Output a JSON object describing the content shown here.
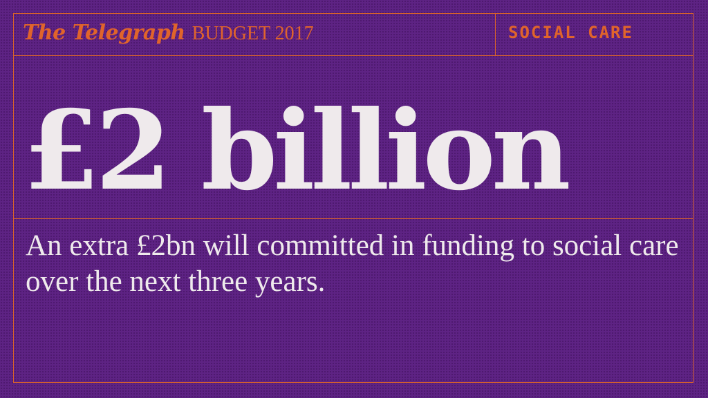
{
  "header": {
    "logo": "The Telegraph",
    "edition": "BUDGET 2017",
    "section": "SOCIAL CARE"
  },
  "main": {
    "headline": "£2 billion",
    "body": "An extra £2bn will committed in funding to social care over the next three years."
  },
  "colors": {
    "background": "#5e2384",
    "accent": "#e0642b",
    "text": "#efeaec"
  }
}
